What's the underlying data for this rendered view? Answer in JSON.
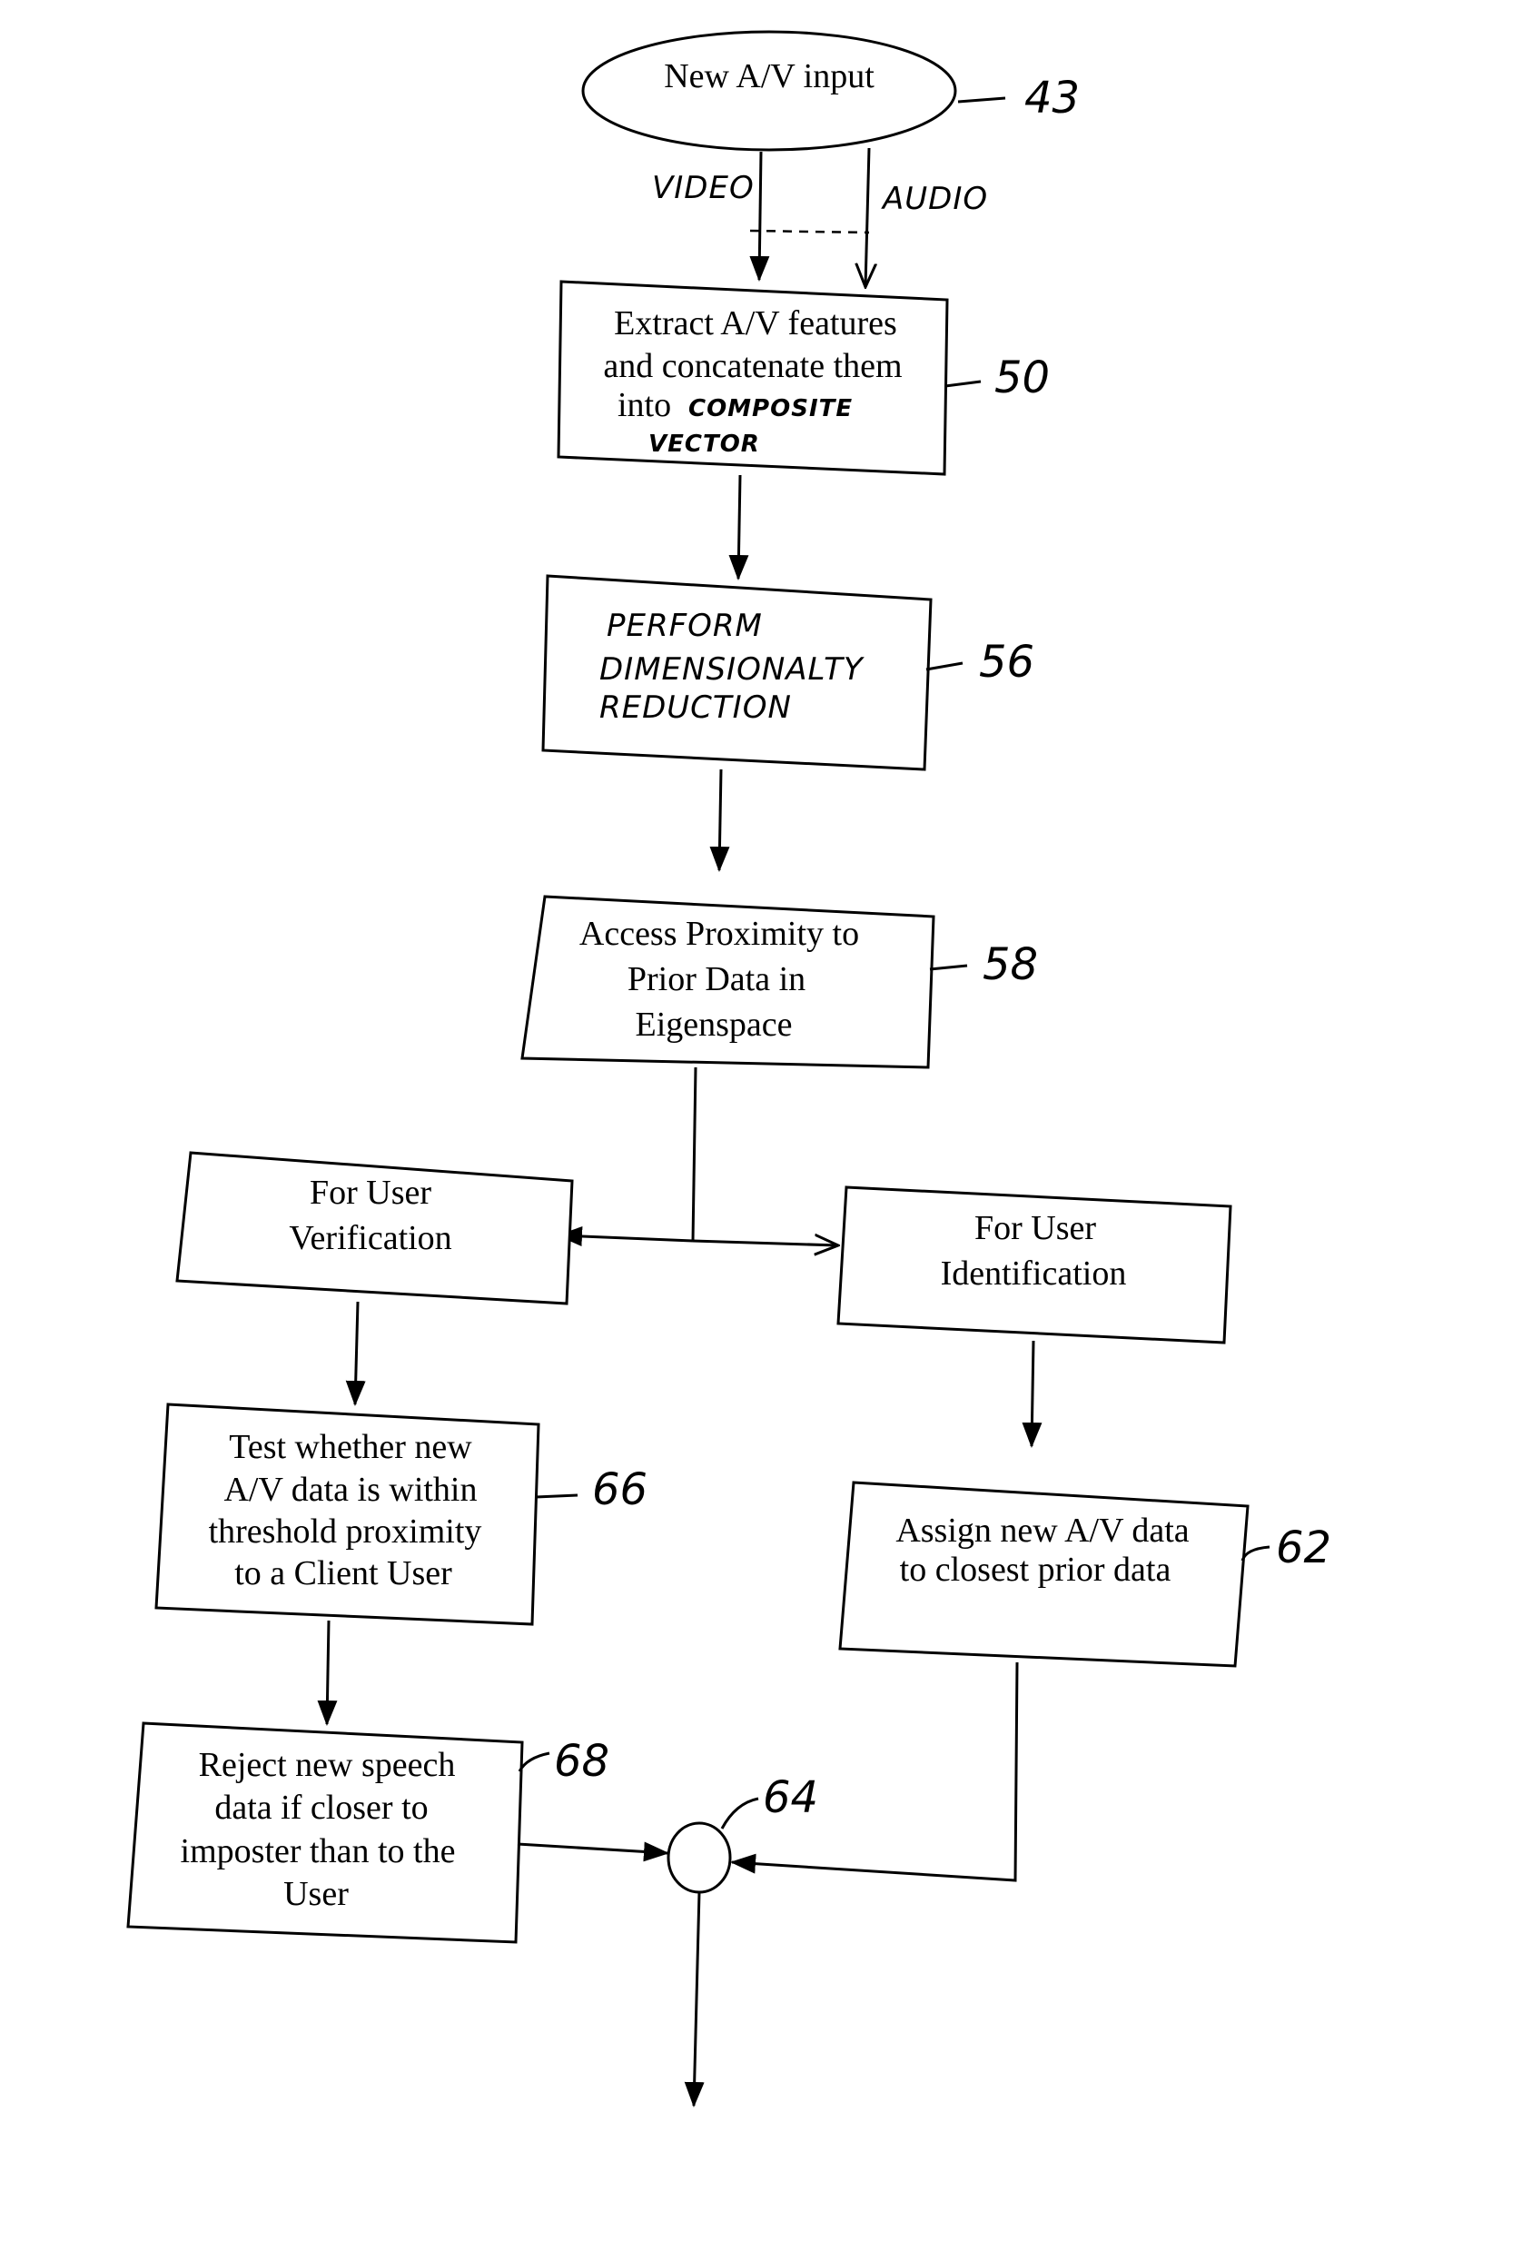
{
  "diagram": {
    "start": {
      "label": "New A/V input",
      "ref": "43"
    },
    "edges_start": {
      "video_label": "VIDEO",
      "audio_label": "AUDIO"
    },
    "box50": {
      "lines": [
        "Extract A/V features",
        "and concatenate them",
        "into"
      ],
      "hand_lines": [
        "COMPOSITE",
        "VECTOR"
      ],
      "ref": "50"
    },
    "box56": {
      "hand_lines": [
        "PERFORM",
        "DIMENSIONALTY",
        "REDUCTION"
      ],
      "ref": "56"
    },
    "box58": {
      "lines": [
        "Access Proximity to",
        "Prior Data in",
        "Eigenspace"
      ],
      "ref": "58"
    },
    "box_verify": {
      "lines": [
        "For User",
        "Verification"
      ]
    },
    "box_identify": {
      "lines": [
        "For User",
        "Identification"
      ]
    },
    "box66": {
      "lines": [
        "Test whether new",
        "A/V data is within",
        "threshold proximity",
        "to a Client User"
      ],
      "ref": "66"
    },
    "box62": {
      "lines": [
        "Assign new A/V data",
        "to closest prior data"
      ],
      "ref": "62"
    },
    "box68": {
      "lines": [
        "Reject new speech",
        "data if closer to",
        "imposter than to the",
        "User"
      ],
      "ref": "68"
    },
    "junction": {
      "ref": "64"
    }
  }
}
